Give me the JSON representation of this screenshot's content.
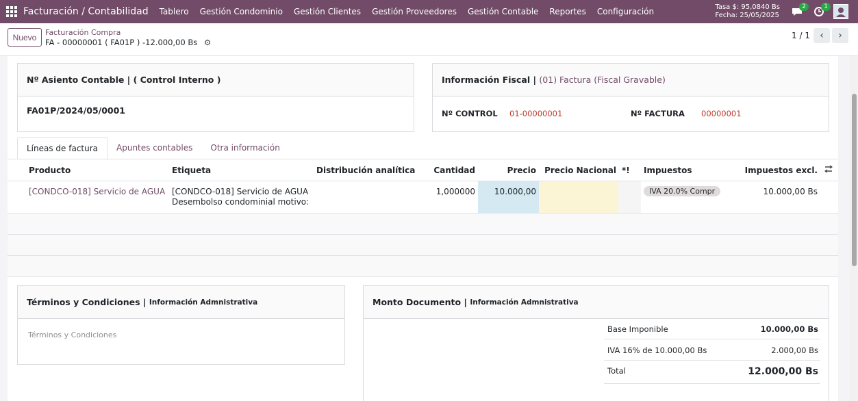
{
  "navbar": {
    "title": "Facturación / Contabilidad",
    "menu": [
      "Tablero",
      "Gestión Condominio",
      "Gestión Clientes",
      "Gestión Proveedores",
      "Gestión Contable",
      "Reportes",
      "Configuración"
    ],
    "rate": "Tasa $: 95,0840 Bs",
    "date": "Fecha: 25/05/2025",
    "messages_count": "2",
    "activities_count": "1",
    "accent_color": "#714b67"
  },
  "control": {
    "new_label": "Nuevo",
    "breadcrumb_parent": "Facturación Compra",
    "breadcrumb_current": "FA - 00000001 ( FA01P ) -12.000,00 Bs",
    "pager": "1 / 1"
  },
  "asiento": {
    "title": "Nº Asiento Contable | ( Control Interno )",
    "value": "FA01P/2024/05/0001"
  },
  "fiscal": {
    "title_prefix": "Información Fiscal |",
    "title_value": "(01) Factura (Fiscal Gravable)",
    "control_label": "Nº CONTROL",
    "control_value": "01-00000001",
    "factura_label": "Nº FACTURA",
    "factura_value": "00000001"
  },
  "tabs": [
    "Líneas de factura",
    "Apuntes contables",
    "Otra información"
  ],
  "table": {
    "headers": {
      "producto": "Producto",
      "etiqueta": "Etiqueta",
      "distribucion": "Distribución analítica",
      "cantidad": "Cantidad",
      "precio": "Precio",
      "precio_nacional": "Precio Nacional",
      "flag": "*!",
      "impuestos": "Impuestos",
      "impuestos_excl": "Impuestos excl."
    },
    "rows": [
      {
        "producto": "[CONDCO-018] Servicio de AGUA",
        "etiqueta_1": "[CONDCO-018] Servicio de AGUA",
        "etiqueta_2": "Desembolso condominial motivo:",
        "cantidad": "1,000000",
        "precio": "10.000,00",
        "impuesto": "IVA 20.0% Compr",
        "subtotal": "10.000,00 Bs"
      }
    ]
  },
  "terminos": {
    "title": "Términos y Condiciones |",
    "subtitle": "Información Admnistrativa",
    "placeholder": "Términos y Condiciones"
  },
  "monto": {
    "title": "Monto Documento |",
    "subtitle": "Información Admnistrativa",
    "base_label": "Base Imponible",
    "base_value": "10.000,00 Bs",
    "iva_label": "IVA 16% de 10.000,00 Bs",
    "iva_value": "2.000,00 Bs",
    "total_label": "Total",
    "total_value": "12.000,00 Bs"
  }
}
